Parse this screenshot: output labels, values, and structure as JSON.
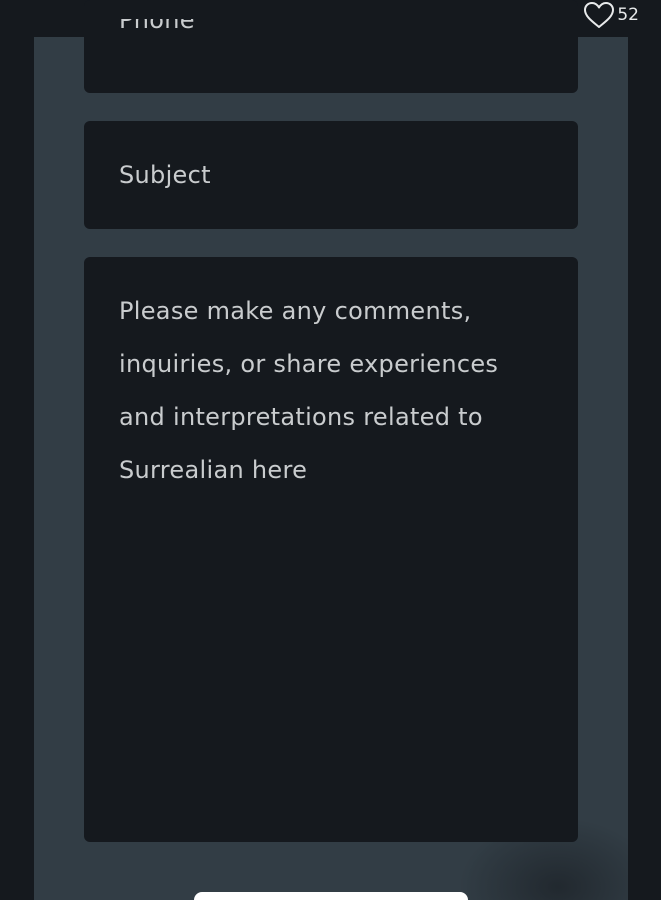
{
  "form": {
    "phone_placeholder": "Phone",
    "subject_placeholder": "Subject",
    "message_placeholder": "Please make any comments, inquiries, or share experiences and interpretations related to Surrealian here"
  },
  "like": {
    "count": "52",
    "icon": "heart-outline-icon"
  },
  "colors": {
    "page_background": "#15191e",
    "form_panel": "#323d45",
    "field_background": "#15191e",
    "placeholder_text": "#c9ccce",
    "button": "#ffffff"
  }
}
